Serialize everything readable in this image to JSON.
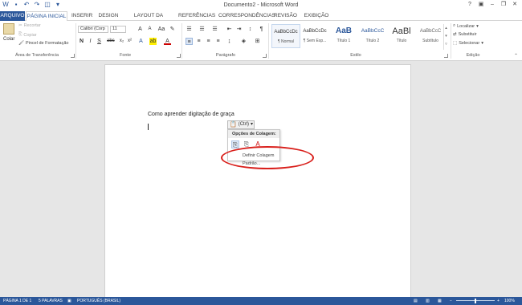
{
  "window": {
    "title": "Documento2 - Microsoft Word"
  },
  "tabs": [
    {
      "label": "ARQUIVO"
    },
    {
      "label": "PÁGINA INICIAL"
    },
    {
      "label": "INSERIR"
    },
    {
      "label": "DESIGN"
    },
    {
      "label": "LAYOUT DA PÁGINA"
    },
    {
      "label": "REFERÊNCIAS"
    },
    {
      "label": "CORRESPONDÊNCIAS"
    },
    {
      "label": "REVISÃO"
    },
    {
      "label": "EXIBIÇÃO"
    }
  ],
  "clipboard": {
    "paste": "Colar",
    "cut": "Recortar",
    "copy": "Copiar",
    "format_painter": "Pincel de Formatação",
    "label": "Área de Transferência"
  },
  "font": {
    "name": "Calibri (Corp",
    "size": "11",
    "label": "Fonte"
  },
  "paragraph": {
    "label": "Parágrafo"
  },
  "styles": {
    "items": [
      {
        "preview": "AaBbCcDc",
        "name": "¶ Normal"
      },
      {
        "preview": "AaBbCcDc",
        "name": "¶ Sem Esp..."
      },
      {
        "preview": "AaB",
        "name": "Título 1"
      },
      {
        "preview": "AaBbCcC",
        "name": "Título 2"
      },
      {
        "preview": "AaBl",
        "name": "Título"
      },
      {
        "preview": "AaBbCcC",
        "name": "Subtítulo"
      }
    ],
    "label": "Estilo"
  },
  "editing": {
    "find": "Localizar",
    "replace": "Substituir",
    "select": "Selecionar",
    "label": "Edição"
  },
  "document": {
    "text": "Como aprender digitação de graça"
  },
  "paste_options": {
    "button_label": "(Ctrl)",
    "menu_title": "Opções de Colagem:",
    "default_item": "Definir Colagem Padrão..."
  },
  "status": {
    "page": "PÁGINA 1 DE 1",
    "words": "5 PALAVRAS",
    "language": "PORTUGUÊS (BRASIL)",
    "zoom": "100%"
  },
  "colors": {
    "accent": "#2b579a",
    "highlight": "#d9201c"
  }
}
